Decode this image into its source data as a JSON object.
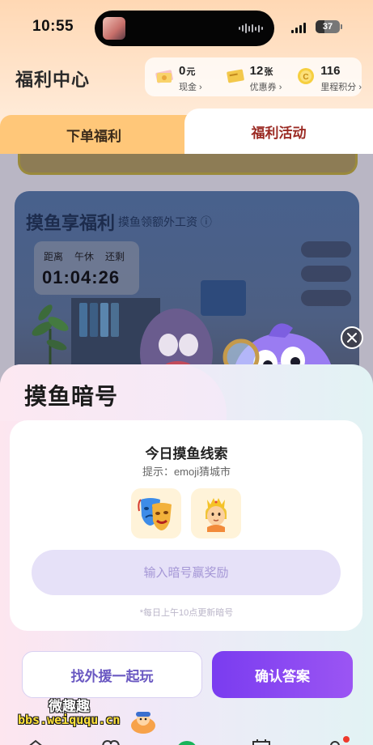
{
  "status_bar": {
    "time": "10:55",
    "battery": "37"
  },
  "header": {
    "title": "福利中心",
    "stats": [
      {
        "value": "0",
        "unit": "元",
        "label": "现金 ›",
        "icon": "cash-icon"
      },
      {
        "value": "12",
        "unit": "张",
        "label": "优惠券 ›",
        "icon": "coupon-icon"
      },
      {
        "value": "116",
        "unit": "",
        "label": "里程积分 ›",
        "icon": "coin-icon"
      }
    ]
  },
  "tabs": [
    {
      "label": "下单福利",
      "active": false
    },
    {
      "label": "福利活动",
      "active": true
    }
  ],
  "background_card": {
    "title": "摸鱼享福利",
    "subtitle": "摸鱼领额外工资",
    "timer_labels": [
      "距离",
      "午休",
      "还剩"
    ],
    "timer": "01:04:26"
  },
  "modal": {
    "title": "摸鱼暗号",
    "clue_title": "今日摸鱼线索",
    "hint": "提示：emoji猜城市",
    "emojis": [
      "🎭",
      "👸"
    ],
    "input_placeholder": "输入暗号赢奖励",
    "note": "*每日上午10点更新暗号",
    "help_button": "找外援一起玩",
    "confirm_button": "确认答案"
  },
  "watermark": {
    "cn": "微趣趣",
    "url": "bbs.weiququ.cn"
  },
  "colors": {
    "accent_purple": "#8b48f2",
    "tab_active_text": "#9b2b24",
    "tab_inactive_bg": "#ffc779"
  }
}
